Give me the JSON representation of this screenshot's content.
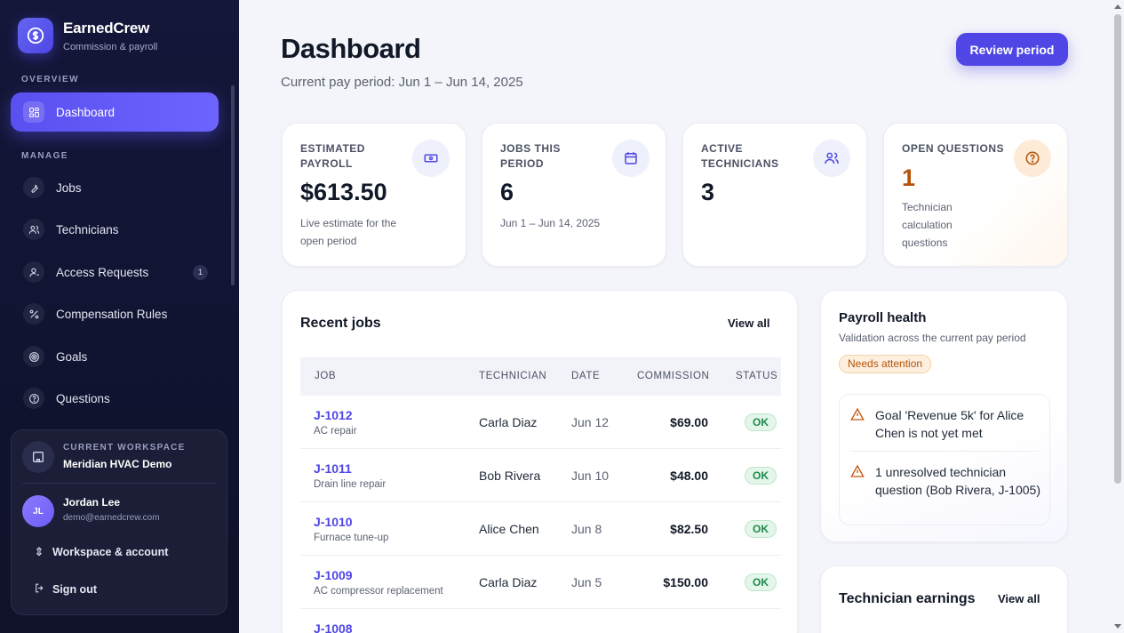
{
  "brand": {
    "name": "EarnedCrew",
    "subtitle": "Commission & payroll"
  },
  "sidebar": {
    "overview_label": "OVERVIEW",
    "manage_label": "MANAGE",
    "items": [
      {
        "label": "Dashboard",
        "icon": "grid-icon"
      },
      {
        "label": "Jobs",
        "icon": "wrench-icon"
      },
      {
        "label": "Technicians",
        "icon": "users-icon"
      },
      {
        "label": "Access Requests",
        "icon": "user-icon",
        "badge": "1"
      },
      {
        "label": "Compensation Rules",
        "icon": "percent-icon"
      },
      {
        "label": "Goals",
        "icon": "target-icon"
      },
      {
        "label": "Questions",
        "icon": "help-circle-icon"
      }
    ],
    "workspace": {
      "label": "CURRENT WORKSPACE",
      "name": "Meridian HVAC Demo",
      "user_initials": "JL",
      "user_name": "Jordan Lee",
      "user_email": "demo@earnedcrew.com",
      "switch_label": "Workspace & account",
      "signout_label": "Sign out"
    }
  },
  "header": {
    "title": "Dashboard",
    "subtitle": "Current pay period: Jun 1 – Jun 14, 2025",
    "review_button": "Review period"
  },
  "stats": [
    {
      "label": "ESTIMATED PAYROLL",
      "value": "$613.50",
      "note": "Live estimate for the open period",
      "icon": "cash-icon"
    },
    {
      "label": "JOBS THIS PERIOD",
      "value": "6",
      "note": "Jun 1 – Jun 14, 2025",
      "icon": "calendar-icon"
    },
    {
      "label": "ACTIVE TECHNICIANS",
      "value": "3",
      "note": "",
      "icon": "users-icon"
    },
    {
      "label": "OPEN QUESTIONS",
      "value": "1",
      "note": "Technician calculation questions",
      "icon": "help-circle-icon"
    }
  ],
  "recent_jobs": {
    "title": "Recent jobs",
    "view_all": "View all",
    "columns": [
      "JOB",
      "TECHNICIAN",
      "DATE",
      "COMMISSION",
      "STATUS"
    ],
    "rows": [
      {
        "job": "J-1012",
        "desc": "AC repair",
        "tech": "Carla Diaz",
        "date": "Jun 12",
        "amount": "$69.00",
        "status": "OK"
      },
      {
        "job": "J-1011",
        "desc": "Drain line repair",
        "tech": "Bob Rivera",
        "date": "Jun 10",
        "amount": "$48.00",
        "status": "OK"
      },
      {
        "job": "J-1010",
        "desc": "Furnace tune-up",
        "tech": "Alice Chen",
        "date": "Jun 8",
        "amount": "$82.50",
        "status": "OK"
      },
      {
        "job": "J-1009",
        "desc": "AC compressor replacement",
        "tech": "Carla Diaz",
        "date": "Jun 5",
        "amount": "$150.00",
        "status": "OK"
      },
      {
        "job": "J-1008",
        "desc": "",
        "tech": "",
        "date": "",
        "amount": "",
        "status": ""
      }
    ]
  },
  "payroll_health": {
    "title": "Payroll health",
    "subtitle": "Validation across the current pay period",
    "badge": "Needs attention",
    "issues": [
      "Goal 'Revenue 5k' for Alice Chen is not yet met",
      "1 unresolved technician question (Bob Rivera, J-1005)"
    ]
  },
  "technician_earnings": {
    "title": "Technician earnings",
    "view_all": "View all"
  },
  "colors": {
    "accent": "#4f46e5",
    "sidebar": "#111433",
    "warning": "#b45309",
    "success": "#1f8a4c"
  }
}
